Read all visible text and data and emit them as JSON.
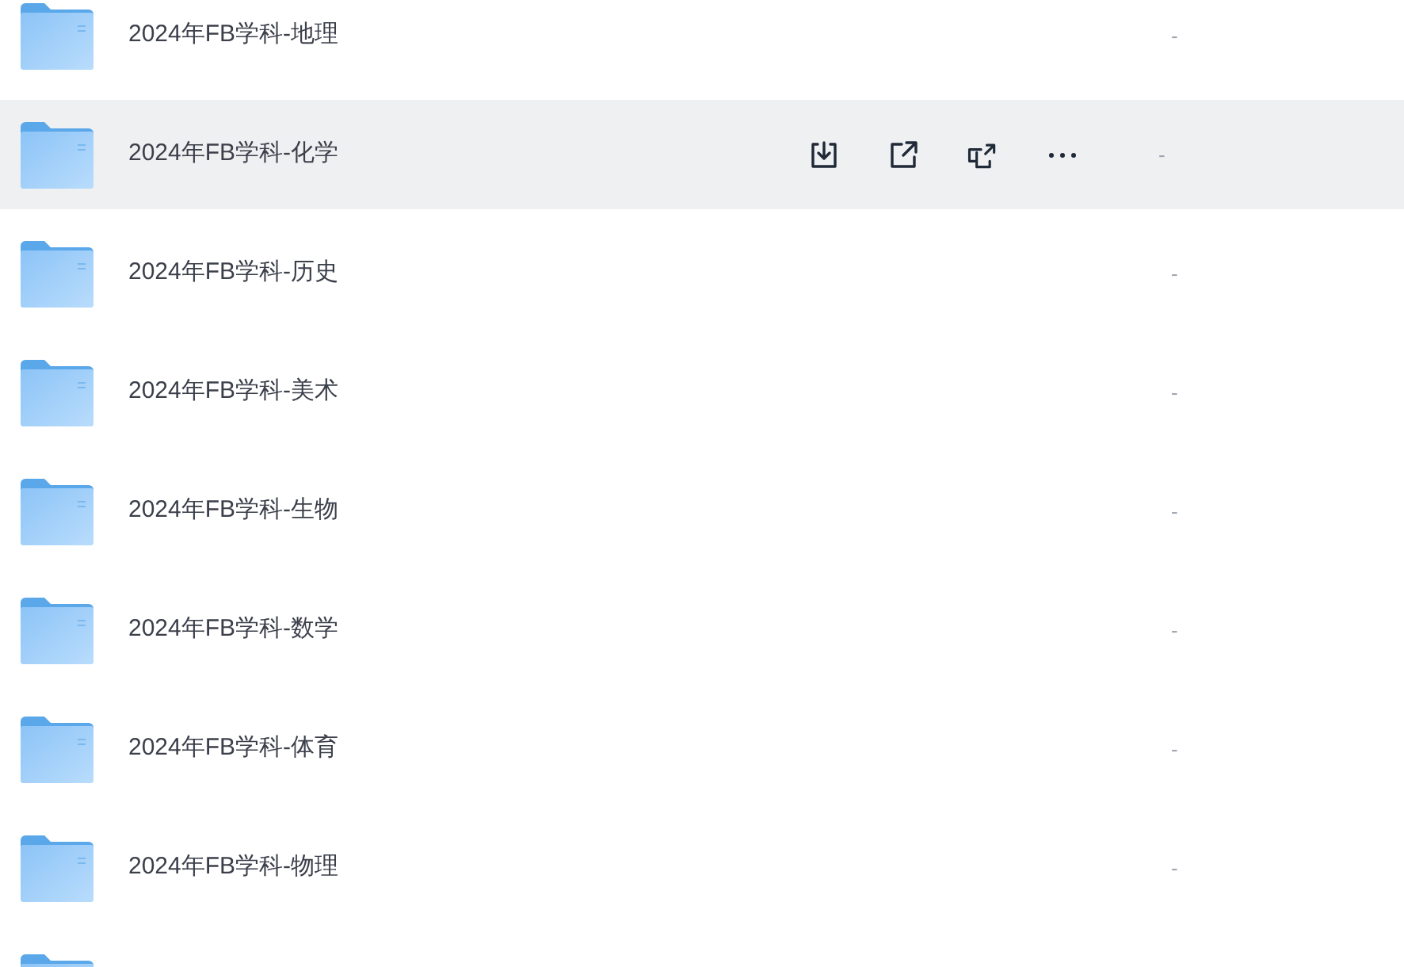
{
  "files": [
    {
      "name": "2024年FB学科-地理",
      "size": "-",
      "selected": false
    },
    {
      "name": "2024年FB学科-化学",
      "size": "-",
      "selected": true
    },
    {
      "name": "2024年FB学科-历史",
      "size": "-",
      "selected": false
    },
    {
      "name": "2024年FB学科-美术",
      "size": "-",
      "selected": false
    },
    {
      "name": "2024年FB学科-生物",
      "size": "-",
      "selected": false
    },
    {
      "name": "2024年FB学科-数学",
      "size": "-",
      "selected": false
    },
    {
      "name": "2024年FB学科-体育",
      "size": "-",
      "selected": false
    },
    {
      "name": "2024年FB学科-物理",
      "size": "-",
      "selected": false
    },
    {
      "selected": false
    }
  ]
}
